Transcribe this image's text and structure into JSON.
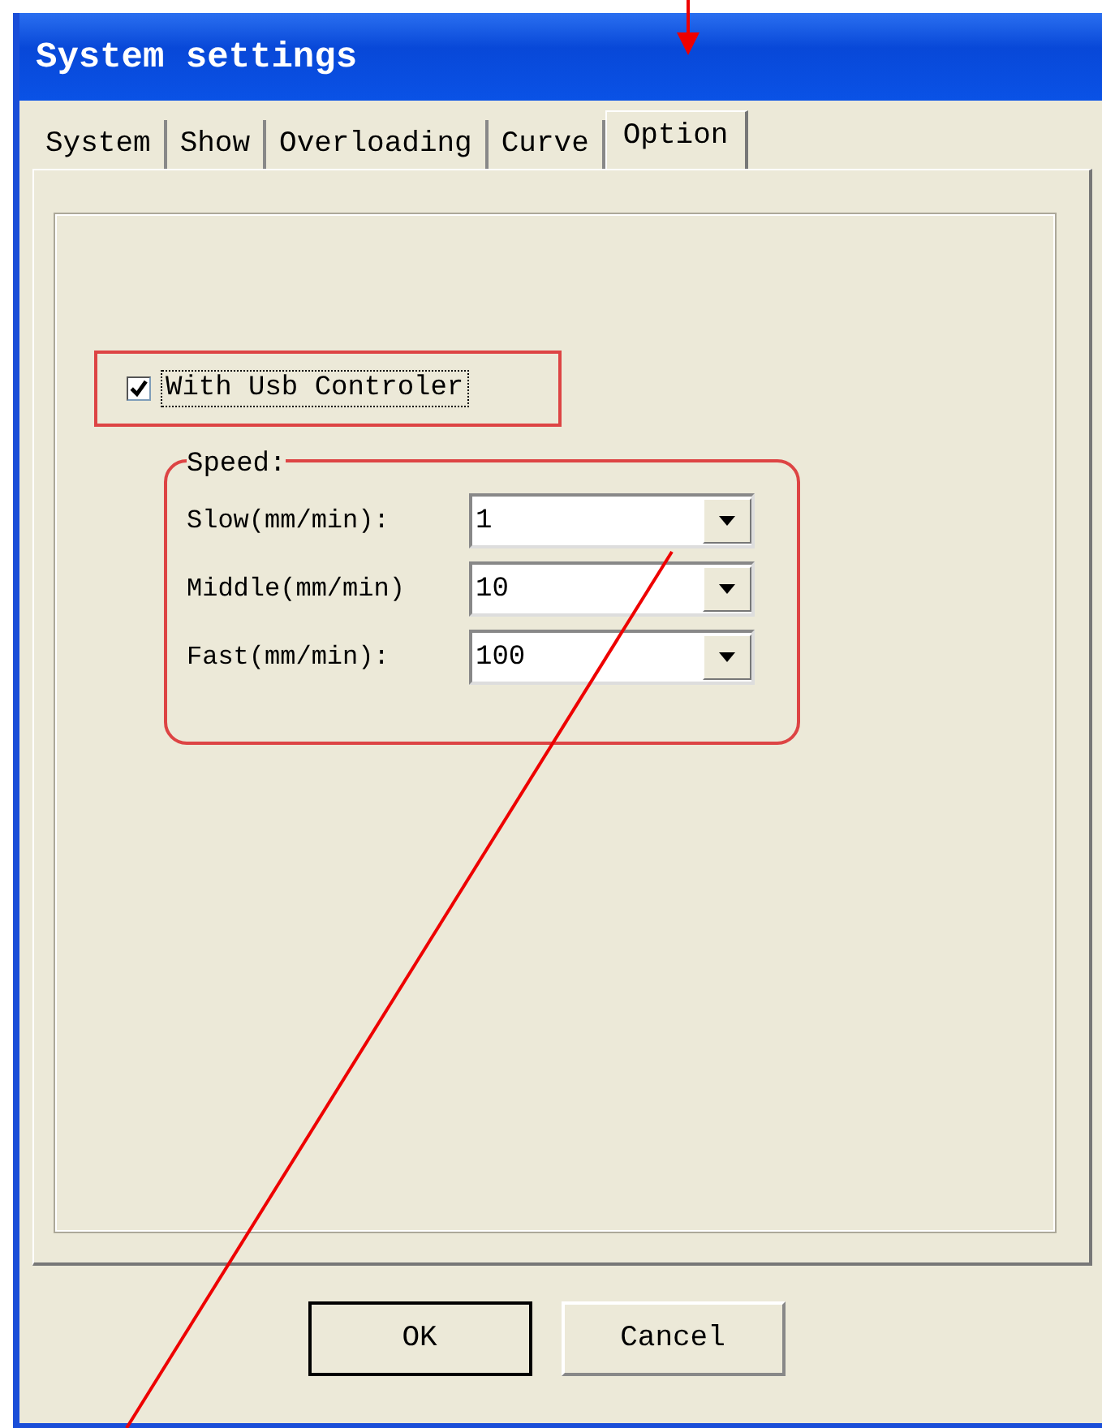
{
  "window": {
    "title": "System settings"
  },
  "tabs": [
    {
      "label": "System",
      "selected": false
    },
    {
      "label": "Show",
      "selected": false
    },
    {
      "label": "Overloading",
      "selected": false
    },
    {
      "label": "Curve",
      "selected": false
    },
    {
      "label": "Option",
      "selected": true
    }
  ],
  "usb_checkbox": {
    "label": "With Usb Controler",
    "checked": true
  },
  "speed": {
    "title": "Speed:",
    "rows": [
      {
        "label": "Slow(mm/min):",
        "value": "1"
      },
      {
        "label": "Middle(mm/min)",
        "value": "10"
      },
      {
        "label": "Fast(mm/min):",
        "value": "100"
      }
    ]
  },
  "buttons": [
    {
      "label": "OK",
      "default": true
    },
    {
      "label": "Cancel",
      "default": false
    }
  ]
}
